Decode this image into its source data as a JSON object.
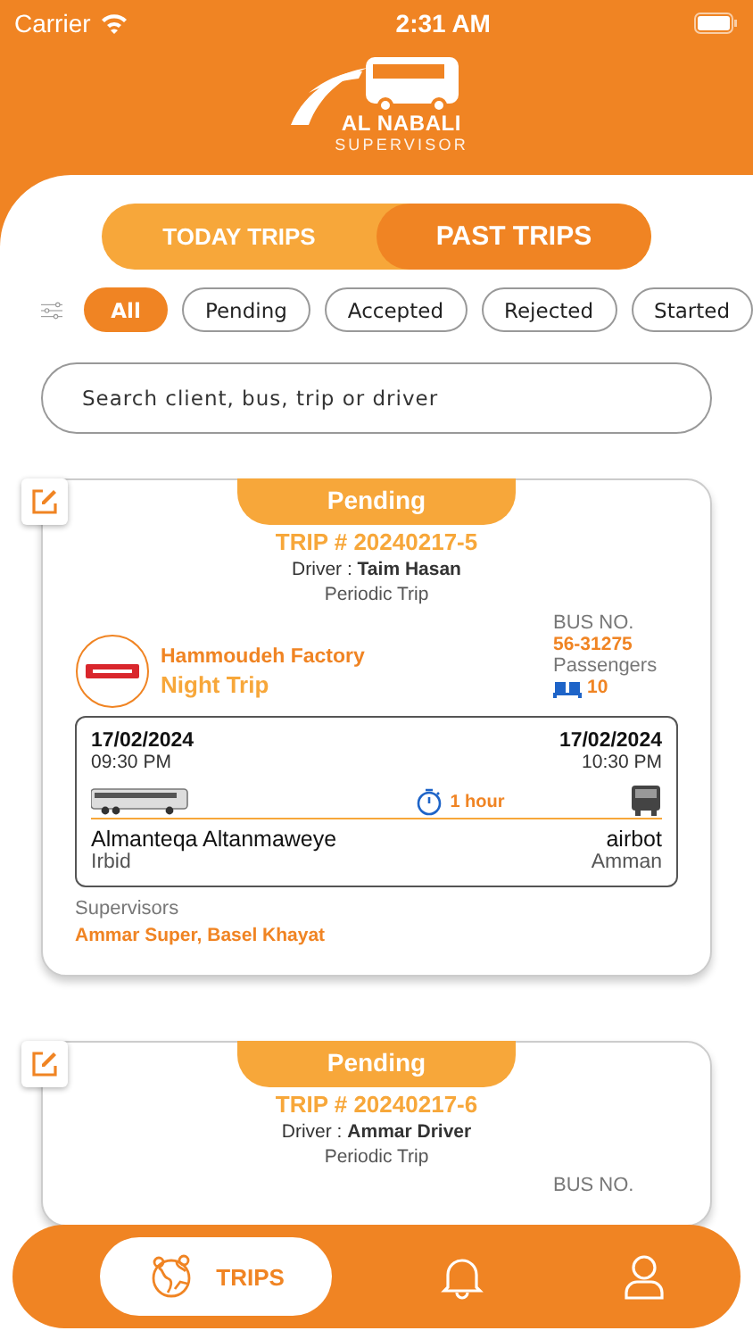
{
  "status_bar": {
    "carrier": "Carrier",
    "time": "2:31 AM"
  },
  "logo": {
    "title": "AL NABALI",
    "subtitle": "SUPERVISOR"
  },
  "segments": [
    {
      "label": "TODAY TRIPS",
      "selected": false
    },
    {
      "label": "PAST TRIPS",
      "selected": true
    }
  ],
  "filters": [
    {
      "label": "All",
      "selected": true
    },
    {
      "label": "Pending",
      "selected": false
    },
    {
      "label": "Accepted",
      "selected": false
    },
    {
      "label": "Rejected",
      "selected": false
    },
    {
      "label": "Started",
      "selected": false
    }
  ],
  "search": {
    "placeholder": "Search client, bus, trip or driver"
  },
  "trips": [
    {
      "status": "Pending",
      "trip_no": "TRIP # 20240217-5",
      "driver_label": "Driver :",
      "driver": "Taim Hasan",
      "trip_type": "Periodic Trip",
      "client": "Hammoudeh Factory",
      "shift": "Night Trip",
      "bus_label": "BUS NO.",
      "bus_no": "56-31275",
      "passengers_label": "Passengers",
      "passengers": "10",
      "start_date": "17/02/2024",
      "start_time": "09:30 PM",
      "end_date": "17/02/2024",
      "end_time": "10:30 PM",
      "duration": "1 hour",
      "from": "Almanteqa Altanmaweye",
      "from_city": "Irbid",
      "to": "airbot",
      "to_city": "Amman",
      "supervisors_label": "Supervisors",
      "supervisors": "Ammar Super, Basel Khayat"
    },
    {
      "status": "Pending",
      "trip_no": "TRIP # 20240217-6",
      "driver_label": "Driver :",
      "driver": "Ammar Driver",
      "trip_type": "Periodic Trip",
      "bus_label": "BUS NO."
    }
  ],
  "tabs": [
    {
      "label": "TRIPS",
      "kind": "trips",
      "selected": true
    },
    {
      "kind": "bell",
      "selected": false
    },
    {
      "kind": "profile",
      "selected": false
    }
  ]
}
